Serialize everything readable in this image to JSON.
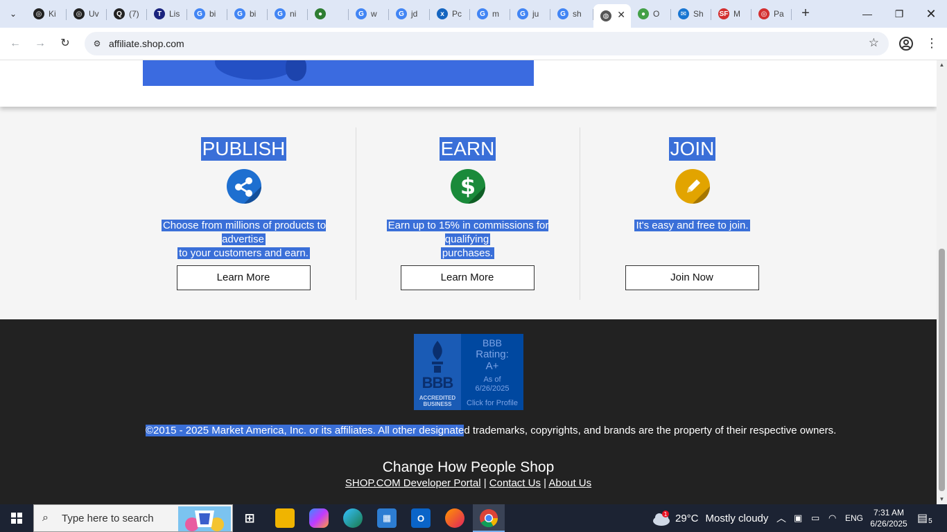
{
  "browser": {
    "tabs": [
      {
        "label": "Ki",
        "fav_color": "#222",
        "fav_glyph": "◎"
      },
      {
        "label": "Uv",
        "fav_color": "#222",
        "fav_glyph": "◎"
      },
      {
        "label": "(7)",
        "fav_color": "#222",
        "fav_glyph": "Q"
      },
      {
        "label": "Lis",
        "fav_color": "#1a237e",
        "fav_glyph": "T"
      },
      {
        "label": "bi",
        "fav_color": "#4285f4",
        "fav_glyph": "G"
      },
      {
        "label": "bi",
        "fav_color": "#4285f4",
        "fav_glyph": "G"
      },
      {
        "label": "ni",
        "fav_color": "#4285f4",
        "fav_glyph": "G"
      },
      {
        "label": "",
        "fav_color": "#2e7d32",
        "fav_glyph": "●"
      },
      {
        "label": "w",
        "fav_color": "#4285f4",
        "fav_glyph": "G"
      },
      {
        "label": "jd",
        "fav_color": "#4285f4",
        "fav_glyph": "G"
      },
      {
        "label": "Pc",
        "fav_color": "#1565c0",
        "fav_glyph": "x"
      },
      {
        "label": "m",
        "fav_color": "#4285f4",
        "fav_glyph": "G"
      },
      {
        "label": "ju",
        "fav_color": "#4285f4",
        "fav_glyph": "G"
      },
      {
        "label": "sh",
        "fav_color": "#4285f4",
        "fav_glyph": "G"
      },
      {
        "label": "",
        "fav_color": "#555",
        "fav_glyph": "◍",
        "active": true
      },
      {
        "label": "O",
        "fav_color": "#43a047",
        "fav_glyph": "●"
      },
      {
        "label": "Sh",
        "fav_color": "#1976d2",
        "fav_glyph": "✉"
      },
      {
        "label": "M",
        "fav_color": "#d32f2f",
        "fav_glyph": "SF"
      },
      {
        "label": "Pa",
        "fav_color": "#d32f2f",
        "fav_glyph": "◎"
      }
    ],
    "url": "affiliate.shop.com"
  },
  "features": [
    {
      "title": "PUBLISH",
      "icon": "share-icon",
      "color": "#1e6fd0",
      "desc_lines": [
        "Choose from millions of products to advertise",
        "to your customers and earn."
      ],
      "button": "Learn More"
    },
    {
      "title": "EARN",
      "icon": "dollar-icon",
      "color": "#1a8a3a",
      "desc_lines": [
        "Earn up to 15% in commissions for qualifying",
        "purchases."
      ],
      "button": "Learn More"
    },
    {
      "title": "JOIN",
      "icon": "pencil-icon",
      "color": "#e2a400",
      "desc_lines": [
        "It's easy and free to join."
      ],
      "button": "Join Now"
    }
  ],
  "footer": {
    "bbb": {
      "seal_text": "BBB",
      "accredited": "ACCREDITED BUSINESS",
      "rating_label": "BBB",
      "rating_label2": "Rating:",
      "rating_value": "A+",
      "as_of": "As of",
      "as_of_date": "6/26/2025",
      "click": "Click for Profile"
    },
    "copyright_selected": "©2015 - 2025 Market America, Inc. or its affiliates. All other designate",
    "copyright_rest": "d trademarks, copyrights, and brands are the property of their respective owners.",
    "tagline": "Change How People Shop",
    "links": [
      "SHOP.COM Developer Portal",
      "Contact Us",
      "About Us"
    ],
    "separator": "|"
  },
  "taskbar": {
    "search_placeholder": "Type here to search",
    "weather_temp": "29°C",
    "weather_desc": "Mostly cloudy",
    "weather_badge": "1",
    "language": "ENG",
    "time": "7:31 AM",
    "date": "6/26/2025",
    "notifications": "5"
  }
}
